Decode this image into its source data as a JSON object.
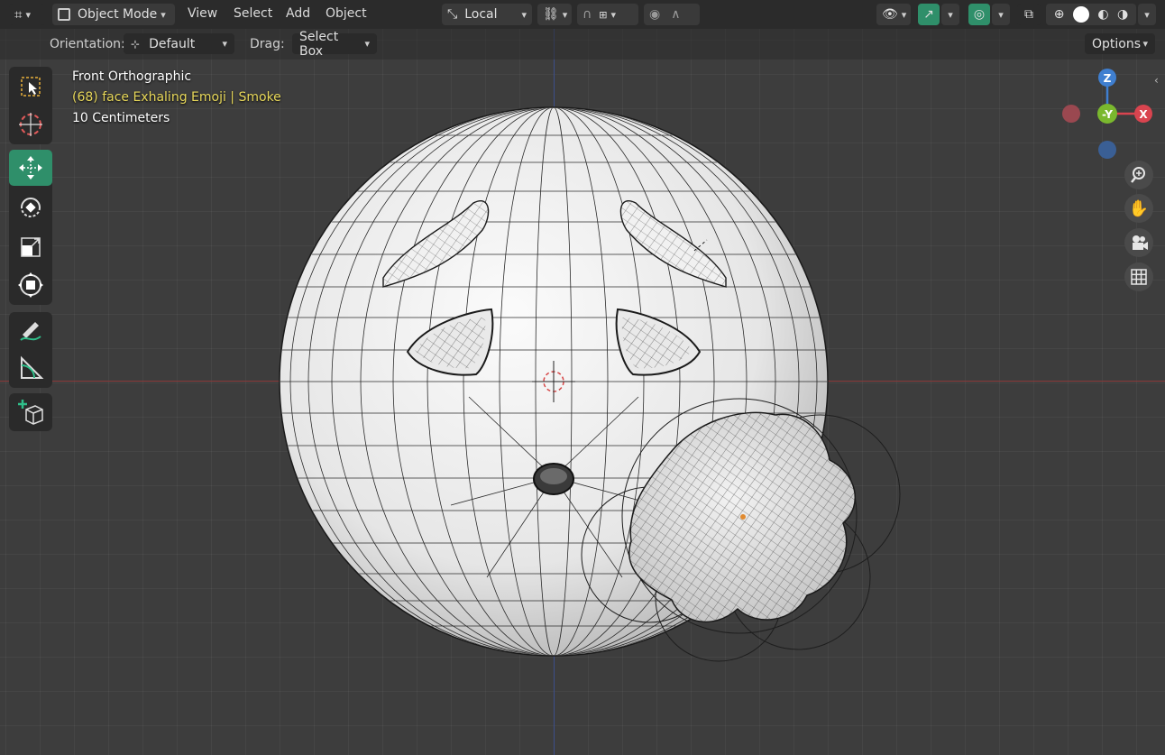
{
  "header": {
    "mode_label": "Object Mode",
    "menus": [
      "View",
      "Select",
      "Add",
      "Object"
    ],
    "transform_orientation": "Local"
  },
  "tool_settings": {
    "orientation_label": "Orientation:",
    "orientation_value": "Default",
    "drag_label": "Drag:",
    "drag_value": "Select Box",
    "options_label": "Options"
  },
  "overlay": {
    "view_name": "Front Orthographic",
    "object_info": "(68) face Exhaling Emoji | Smoke",
    "scale": "10 Centimeters"
  },
  "gizmo": {
    "z_label": "Z",
    "y_label": "-Y",
    "x_label": "X"
  },
  "colors": {
    "accent": "#2f8f6a",
    "x_axis": "#d9444f",
    "y_axis": "#7ab82e",
    "z_axis": "#3f7fd0",
    "header_bg": "#2b2b2b",
    "viewport_bg": "#3d3d3d",
    "info_yellow": "#e8d85a"
  },
  "tools": [
    "select-box",
    "cursor",
    "move",
    "rotate",
    "scale",
    "transform",
    "annotate",
    "measure",
    "add-cube"
  ],
  "nav_icons": [
    "zoom-icon",
    "hand-pan-icon",
    "camera-icon",
    "grid-icon"
  ]
}
